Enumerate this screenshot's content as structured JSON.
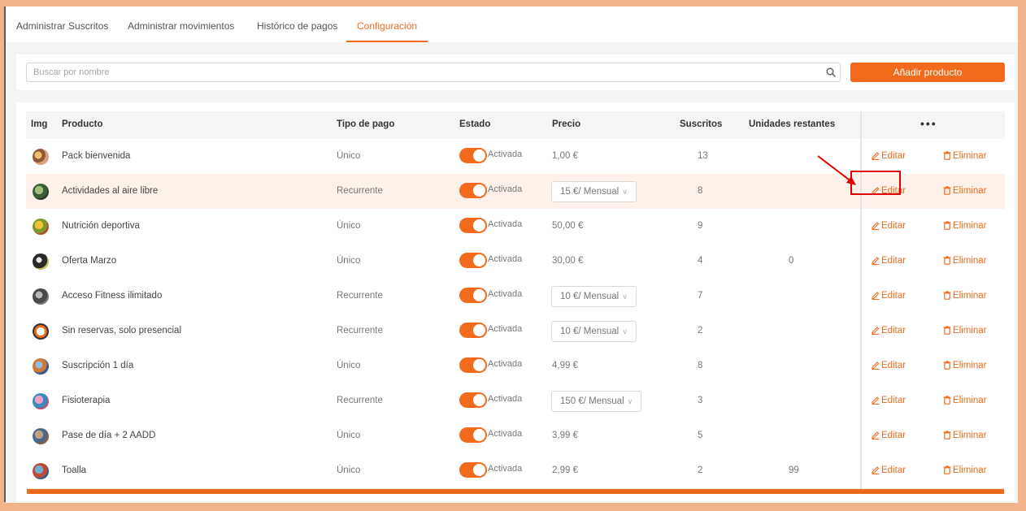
{
  "tabs": [
    {
      "label": "Administrar Suscritos",
      "active": false
    },
    {
      "label": "Administrar movimientos",
      "active": false
    },
    {
      "label": "Histórico de pagos",
      "active": false
    },
    {
      "label": "Configuración",
      "active": true
    }
  ],
  "search": {
    "placeholder": "Buscar por nombre",
    "value": "",
    "icon": "search-icon"
  },
  "add_button_label": "Añadir producto",
  "table": {
    "headers": {
      "img": "Img",
      "product": "Producto",
      "payment_type": "Tipo de pago",
      "status": "Estado",
      "price": "Precio",
      "subscribers": "Suscritos",
      "remaining": "Unidades restantes",
      "more": "•••"
    },
    "edit_label": "Editar",
    "delete_label": "Eliminar",
    "status_label": "Activada",
    "rows": [
      {
        "name": "Pack bienvenida",
        "type": "Único",
        "price": "1,00 €",
        "price_select": false,
        "subscribers": "13",
        "remaining": "",
        "highlight": false
      },
      {
        "name": "Actividades al aire libre",
        "type": "Recurrente",
        "price": "15 €/ Mensual",
        "price_select": true,
        "subscribers": "8",
        "remaining": "",
        "highlight": true
      },
      {
        "name": "Nutrición deportiva",
        "type": "Único",
        "price": "50,00 €",
        "price_select": false,
        "subscribers": "9",
        "remaining": "",
        "highlight": false
      },
      {
        "name": "Oferta Marzo",
        "type": "Único",
        "price": "30,00 €",
        "price_select": false,
        "subscribers": "4",
        "remaining": "0",
        "highlight": false
      },
      {
        "name": "Acceso Fitness ilimitado",
        "type": "Recurrente",
        "price": "10 €/ Mensual",
        "price_select": true,
        "subscribers": "7",
        "remaining": "",
        "highlight": false
      },
      {
        "name": "Sin reservas, solo presencial",
        "type": "Recurrente",
        "price": "10 €/ Mensual",
        "price_select": true,
        "subscribers": "2",
        "remaining": "",
        "highlight": false
      },
      {
        "name": "Suscripción 1 día",
        "type": "Único",
        "price": "4,99 €",
        "price_select": false,
        "subscribers": "8",
        "remaining": "",
        "highlight": false
      },
      {
        "name": "Fisioterapia",
        "type": "Recurrente",
        "price": "150 €/ Mensual",
        "price_select": true,
        "subscribers": "3",
        "remaining": "",
        "highlight": false
      },
      {
        "name": "Pase de día + 2 AADD",
        "type": "Único",
        "price": "3,99 €",
        "price_select": false,
        "subscribers": "5",
        "remaining": "",
        "highlight": false
      },
      {
        "name": "Toalla",
        "type": "Único",
        "price": "2,99 €",
        "price_select": false,
        "subscribers": "2",
        "remaining": "99",
        "highlight": false
      }
    ]
  },
  "colors": {
    "accent": "#f26b1d",
    "annotation": "#e00000",
    "frame": "#f2b48a"
  }
}
